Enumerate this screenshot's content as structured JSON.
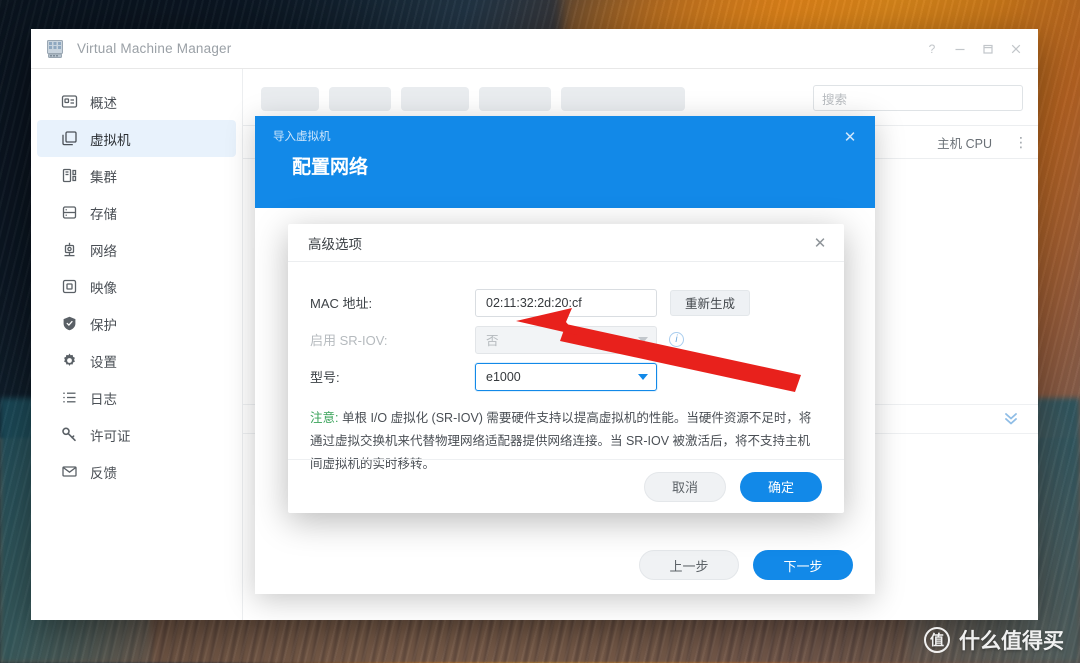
{
  "window": {
    "title": "Virtual Machine Manager",
    "controls": [
      {
        "name": "help",
        "glyph": "?"
      },
      {
        "name": "minimize",
        "glyph": "–"
      },
      {
        "name": "maximize",
        "glyph": "❐"
      },
      {
        "name": "close",
        "glyph": "✕"
      }
    ]
  },
  "sidebar": {
    "items": [
      {
        "label": "概述",
        "icon": "overview-icon",
        "active": false
      },
      {
        "label": "虚拟机",
        "icon": "virtual-machine-icon",
        "active": true
      },
      {
        "label": "集群",
        "icon": "cluster-icon",
        "active": false
      },
      {
        "label": "存储",
        "icon": "storage-icon",
        "active": false
      },
      {
        "label": "网络",
        "icon": "network-icon",
        "active": false
      },
      {
        "label": "映像",
        "icon": "image-icon",
        "active": false
      },
      {
        "label": "保护",
        "icon": "shield-icon",
        "active": false
      },
      {
        "label": "设置",
        "icon": "gear-icon",
        "active": false
      },
      {
        "label": "日志",
        "icon": "log-icon",
        "active": false
      },
      {
        "label": "许可证",
        "icon": "key-icon",
        "active": false
      },
      {
        "label": "反馈",
        "icon": "mail-icon",
        "active": false
      }
    ]
  },
  "content": {
    "search_placeholder": "搜索",
    "column_header": "主机 CPU",
    "kebab_glyph": "⋮",
    "toolbar_button_widths": [
      58,
      62,
      68,
      72,
      124
    ]
  },
  "wizard": {
    "breadcrumb": "导入虚拟机",
    "title": "配置网络",
    "close_glyph": "✕",
    "back_label": "上一步",
    "next_label": "下一步"
  },
  "advanced_dialog": {
    "title": "高级选项",
    "close_glyph": "✕",
    "fields": {
      "mac": {
        "label": "MAC 地址:",
        "value": "02:11:32:2d:20:cf",
        "button_label": "重新生成"
      },
      "sriov": {
        "label": "启用 SR-IOV:",
        "value": "否",
        "info_glyph": "i",
        "disabled": true
      },
      "model": {
        "label": "型号:",
        "value": "e1000",
        "focused": true
      }
    },
    "note_prefix": "注意:",
    "note_text": "单根 I/O 虚拟化 (SR-IOV) 需要硬件支持以提高虚拟机的性能。当硬件资源不足时，将通过虚拟交换机来代替物理网络适配器提供网络连接。当 SR-IOV 被激活后，将不支持主机间虚拟机的实时移转。",
    "cancel_label": "取消",
    "confirm_label": "确定"
  },
  "annotation": {
    "arrow_color": "#e8211c"
  },
  "watermark": {
    "badge": "值",
    "text": "什么值得买"
  },
  "colors": {
    "accent": "#1289e8",
    "sidebar_active_bg": "#e8f2fc",
    "note_warn": "#3aa35a"
  }
}
